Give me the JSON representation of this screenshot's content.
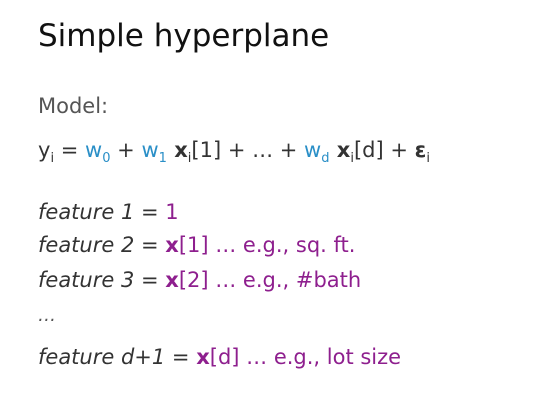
{
  "slide": {
    "title": "Simple hyperplane",
    "model_label": "Model:",
    "equation": {
      "y": "y",
      "y_sub": "i",
      "eq": " = ",
      "w0": "w",
      "w0_sub": "0",
      "plus1": " + ",
      "w1": "w",
      "w1_sub": "1",
      "x1": " x",
      "x1_sub": "i",
      "x1_idx": "[1] + … + ",
      "wd": "w",
      "wd_sub": "d",
      "xd": " x",
      "xd_sub": "i",
      "xd_idx": "[d] + ",
      "eps": "ε",
      "eps_sub": "i"
    },
    "features": [
      {
        "name": "feature 1",
        "eq": " = ",
        "value": "1",
        "value_bold": "",
        "value_rest": ""
      },
      {
        "name": "feature 2",
        "eq": " = ",
        "value": "",
        "value_bold": "x",
        "value_rest": "[1] … e.g., sq. ft."
      },
      {
        "name": "feature 3",
        "eq": " = ",
        "value": "",
        "value_bold": "x",
        "value_rest": "[2] … e.g., #bath"
      },
      {
        "name": "feature d+1",
        "eq": " = ",
        "value": "",
        "value_bold": "x",
        "value_rest": "[d] … e.g., lot size"
      }
    ],
    "ellipsis": "…",
    "colors": {
      "weight": "#2a8fc7",
      "feature_value": "#8e1f8e",
      "text": "#333333"
    }
  }
}
